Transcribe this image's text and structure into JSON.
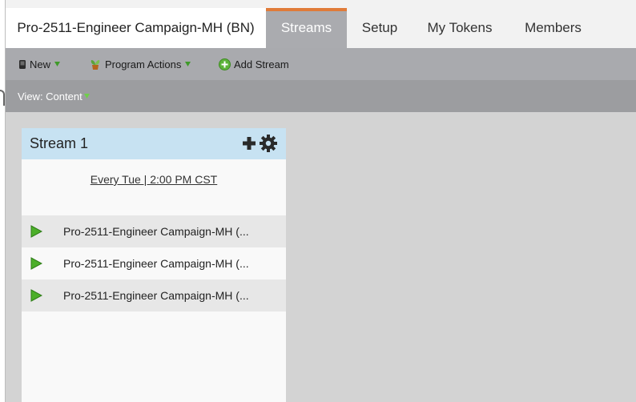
{
  "tabs": {
    "program_name": "Pro-2511-Engineer Campaign-MH (BN)",
    "streams": "Streams",
    "setup": "Setup",
    "my_tokens": "My Tokens",
    "members": "Members"
  },
  "toolbar": {
    "new_label": "New",
    "program_actions_label": "Program Actions",
    "add_stream_label": "Add Stream"
  },
  "view": {
    "label": "View: Content"
  },
  "stream": {
    "title": "Stream 1",
    "schedule": "Every Tue | 2:00 PM CST",
    "items": [
      {
        "name": "Pro-2511-Engineer Campaign-MH (..."
      },
      {
        "name": "Pro-2511-Engineer Campaign-MH (..."
      },
      {
        "name": "Pro-2511-Engineer Campaign-MH (..."
      }
    ]
  },
  "colors": {
    "active_tab_accent": "#e07b39",
    "stream_header": "#c7e2f2",
    "play_green": "#4caf2a"
  },
  "icons": {
    "new": "phone-icon",
    "program_actions": "plant-icon",
    "add_stream": "plus-circle-icon",
    "stream_add": "plus-icon",
    "stream_settings": "gear-icon",
    "stream_item": "play-icon"
  }
}
